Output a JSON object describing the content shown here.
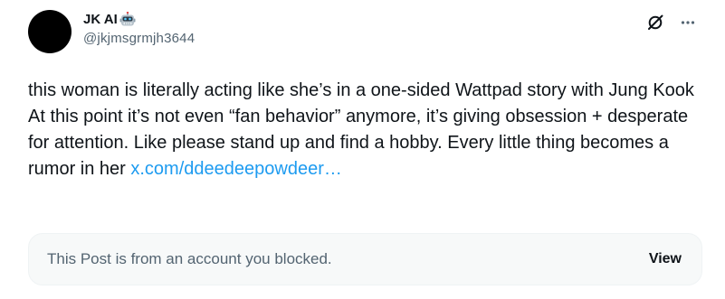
{
  "author": {
    "display_name": "JK AI",
    "badge_emoji": "robot-face-emoji",
    "handle": "@jkjmsgrmjh3644"
  },
  "header_actions": {
    "grok_icon": "grok-icon",
    "more_icon": "more-horizontal-icon"
  },
  "post": {
    "line1": "this woman is literally acting like she’s in a one-sided Wattpad story with Jung Kook",
    "line2_text": "At this point it’s not even “fan behavior” anymore, it’s giving obsession + desperate for attention. Like please stand up and find a hobby. Every little thing becomes a rumor in her ",
    "link_text": "x.com/ddeedeepowdeer…"
  },
  "quoted_notice": {
    "text": "This Post is from an account you blocked.",
    "view_label": "View"
  },
  "colors": {
    "text_primary": "#0f1419",
    "text_secondary": "#536471",
    "link": "#1d9bf0",
    "notice_bg": "#f7f9f9",
    "notice_border": "#eff3f4"
  }
}
